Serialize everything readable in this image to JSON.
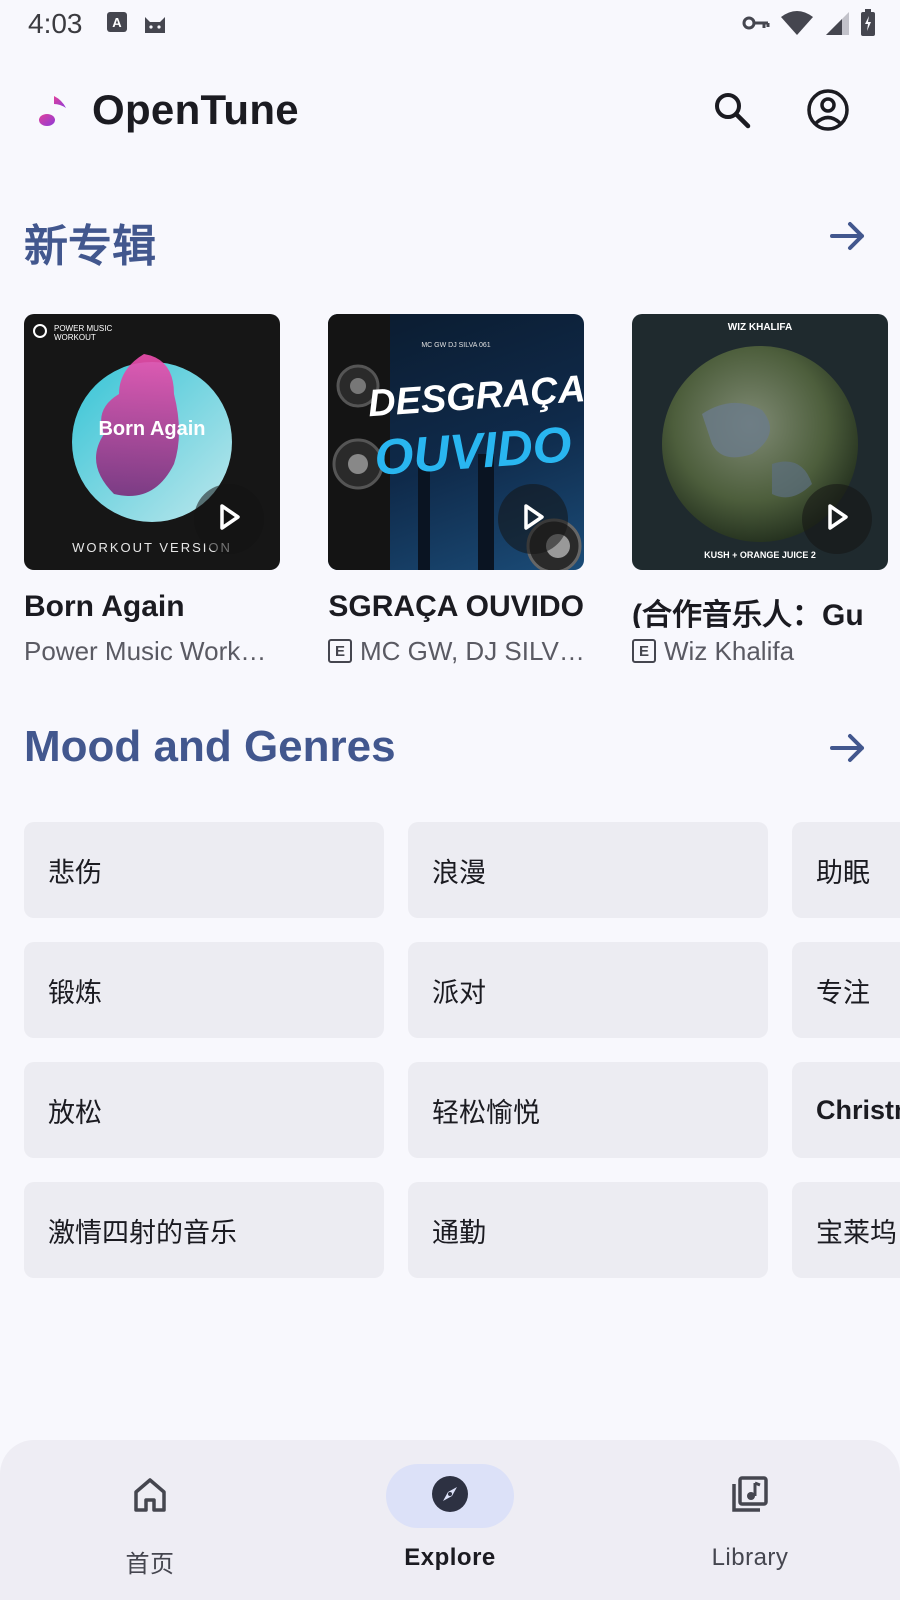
{
  "status_bar": {
    "time": "4:03",
    "left_icons": [
      "font-notification-icon",
      "cat-notification-icon"
    ],
    "right_icons": [
      "vpn-key-icon",
      "wifi-icon",
      "signal-icon",
      "battery-icon"
    ]
  },
  "header": {
    "app_name": "OpenTune",
    "logo_icon": "music-note-logo",
    "actions": [
      "search-icon",
      "account-icon"
    ]
  },
  "new_albums": {
    "title": "新专辑",
    "albums": [
      {
        "title": "Born Again",
        "artist": "Power Music Work…",
        "explicit": false,
        "cover_text": {
          "brand": "POWER MUSIC WORKOUT",
          "main": "Born Again",
          "bottom": "WORKOUT VERSION"
        }
      },
      {
        "title": "DESGRAÇA OUVIDO",
        "artist": "MC GW, DJ SILV…",
        "explicit": true,
        "cover_text": {
          "top": "MC GW   DJ SILVA 061",
          "line1": "DESGRAÇA",
          "line2": "OUVIDO"
        }
      },
      {
        "title": "(合作音乐人：Gu",
        "artist": "Wiz Khalifa",
        "explicit": true,
        "cover_text": {
          "top": "WIZ KHALIFA",
          "bottom": "KUSH + ORANGE JUICE 2"
        }
      }
    ],
    "explicit_badge": "E"
  },
  "mood_genres": {
    "title": "Mood and Genres",
    "chips": [
      {
        "label": "悲伤",
        "bold": false
      },
      {
        "label": "浪漫",
        "bold": false
      },
      {
        "label": "助眠",
        "bold": false
      },
      {
        "label": "锻炼",
        "bold": false
      },
      {
        "label": "派对",
        "bold": false
      },
      {
        "label": "专注",
        "bold": false
      },
      {
        "label": "放松",
        "bold": false
      },
      {
        "label": "轻松愉悦",
        "bold": false
      },
      {
        "label": "Christmas",
        "bold": true
      },
      {
        "label": "激情四射的音乐",
        "bold": false
      },
      {
        "label": "通勤",
        "bold": false
      },
      {
        "label": "宝莱坞",
        "bold": false
      }
    ]
  },
  "bottom_nav": {
    "items": [
      {
        "label": "首页",
        "icon": "home-icon",
        "active": false
      },
      {
        "label": "Explore",
        "icon": "compass-icon",
        "active": true
      },
      {
        "label": "Library",
        "icon": "library-music-icon",
        "active": false
      }
    ]
  },
  "colors": {
    "background": "#f8f8fd",
    "accent": "#42578e",
    "chip": "#ececf2",
    "nav_background": "#eeedf4",
    "nav_active_pill": "#dce1f8"
  }
}
